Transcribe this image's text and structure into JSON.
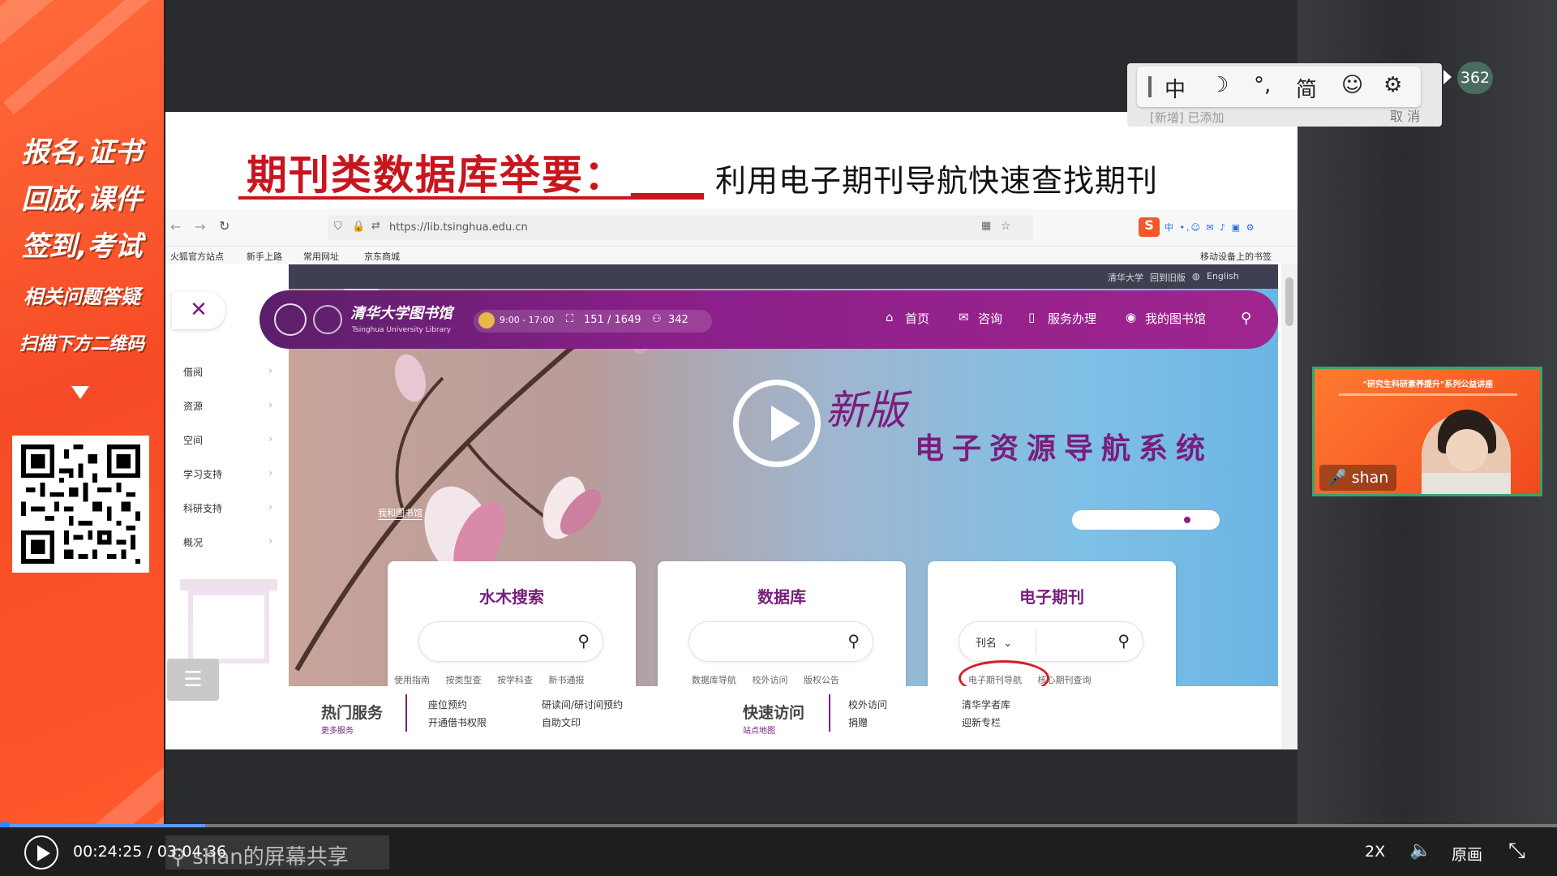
{
  "promo": {
    "line1": "报名,证书",
    "line2": "回放,课件",
    "line3": "签到,考试",
    "line4": "相关问题答疑",
    "line5": "扫描下方二维码"
  },
  "slide": {
    "title_left": "期刊类数据库举要：",
    "title_right": "利用电子期刊导航快速查找期刊"
  },
  "browser": {
    "url": "https://lib.tsinghua.edu.cn",
    "bookmarks": [
      "火狐官方站点",
      "新手上路",
      "常用网址",
      "京东商城"
    ],
    "mobile_bookmarks": "移动设备上的书签"
  },
  "site": {
    "top_links": [
      "清华大学",
      "回到旧版",
      "English"
    ],
    "logo_text": "清华大学图书馆",
    "logo_sub": "Tsinghua University Library",
    "hours": "9:00 - 17:00",
    "seats": "151 / 1649",
    "visitors": "342",
    "nav": [
      "首页",
      "咨询",
      "服务办理",
      "我的图书馆"
    ],
    "sidebar": [
      "借阅",
      "资源",
      "空间",
      "学习支持",
      "科研支持",
      "概况"
    ],
    "hero_new": "新版",
    "hero_title": "电子资源导航系统",
    "hero_tag": "我和图书馆",
    "cards": [
      {
        "title": "水木搜索",
        "links": [
          "使用指南",
          "按类型查",
          "按学科查",
          "新书通报"
        ]
      },
      {
        "title": "数据库",
        "links": [
          "数据库导航",
          "校外访问",
          "版权公告"
        ]
      },
      {
        "title": "电子期刊",
        "select": "刊名",
        "links": [
          "电子期刊导航",
          "核心期刊查询"
        ]
      }
    ],
    "hot_services": {
      "title": "热门服务",
      "more": "更多服务",
      "items": [
        "座位预约",
        "研读间/研讨间预约",
        "开通借书权限",
        "自助文印"
      ]
    },
    "quick_access": {
      "title": "快速访问",
      "more": "站点地图",
      "items": [
        "校外访问",
        "清华学者库",
        "捐赠",
        "迎新专栏"
      ]
    }
  },
  "ime": {
    "items": [
      "中",
      "简"
    ],
    "behind_text": "[新增] 已添加",
    "cancel": "取 消"
  },
  "viewer_count": "362",
  "video": {
    "speaker": "shan",
    "banner": "\"研究生科研素养提升\"系列公益讲座"
  },
  "player": {
    "time": "00:24:25 / 03:04:36",
    "share_label": "shan的屏幕共享",
    "speed": "2X",
    "quality": "原画",
    "progress_fraction": 0.132
  }
}
